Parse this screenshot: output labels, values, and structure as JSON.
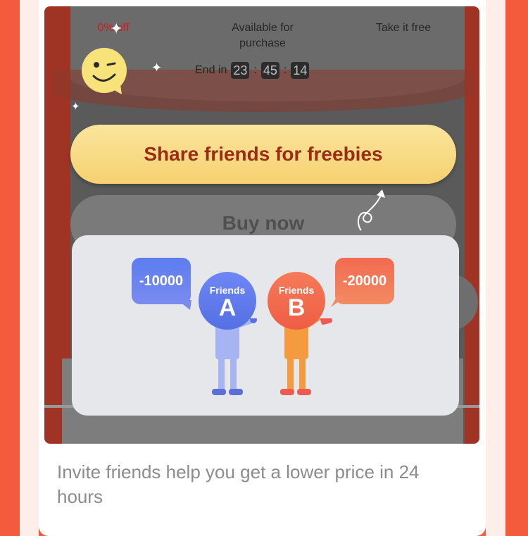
{
  "stats": {
    "discount": "0% off",
    "available": "Available for purchase",
    "take_free": "Take it free"
  },
  "timer": {
    "label": "End in",
    "hours": "23",
    "minutes": "45",
    "seconds": "14",
    "separator": ":"
  },
  "buttons": {
    "share": "Share friends for freebies",
    "buy": "Buy now"
  },
  "popup": {
    "friend_a": {
      "label": "Friends",
      "letter": "A",
      "amount": "-10000"
    },
    "friend_b": {
      "label": "Friends",
      "letter": "B",
      "amount": "-20000"
    }
  },
  "caption": "Invite friends help you get a lower price in 24 hours",
  "icons": [
    "wink-emoji-icon",
    "sparkle-icon",
    "curly-arrow-icon"
  ],
  "colors": {
    "accent": "#f45a3c",
    "share_button": "#f6d170",
    "share_text": "#9b2c16",
    "friend_a": "#5c7df0",
    "friend_b": "#f26a50"
  }
}
